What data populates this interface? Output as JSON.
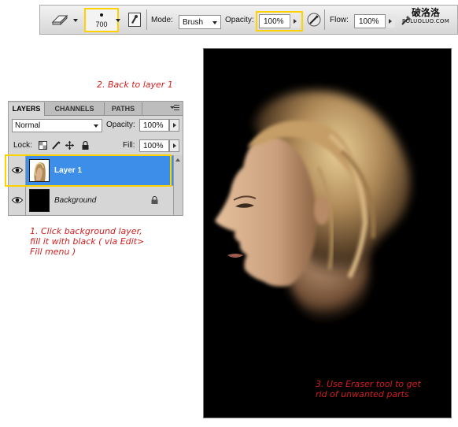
{
  "toolbar": {
    "brush_size": "700",
    "mode_label": "Mode:",
    "mode_value": "Brush",
    "opacity_label": "Opacity:",
    "opacity_value": "100%",
    "flow_label": "Flow:",
    "flow_value": "100%",
    "icons": [
      "eraser-icon",
      "brush-panel-icon",
      "airbrush-icon"
    ]
  },
  "watermark": {
    "top": "破洛洛",
    "bottom": "POLUOLUO.COM"
  },
  "annotations": {
    "step1": "1. Click background layer,\nfill it with black ( via Edit>\nFill menu )",
    "step2": "2. Back to layer 1",
    "step3": "3. Use Eraser tool to get\nrid of unwanted parts"
  },
  "layers_panel": {
    "tabs": [
      "LAYERS",
      "CHANNELS",
      "PATHS"
    ],
    "active_tab": "LAYERS",
    "blend_mode": "Normal",
    "opacity_label": "Opacity:",
    "opacity_value": "100%",
    "lock_label": "Lock:",
    "fill_label": "Fill:",
    "fill_value": "100%",
    "layers": [
      {
        "name": "Layer 1",
        "selected": true,
        "visible": true
      },
      {
        "name": "Background",
        "selected": false,
        "visible": true,
        "locked": true
      }
    ]
  },
  "colors": {
    "highlight": "#ffd200",
    "selection": "#3d8ee9",
    "annotation": "#d21e1e"
  }
}
